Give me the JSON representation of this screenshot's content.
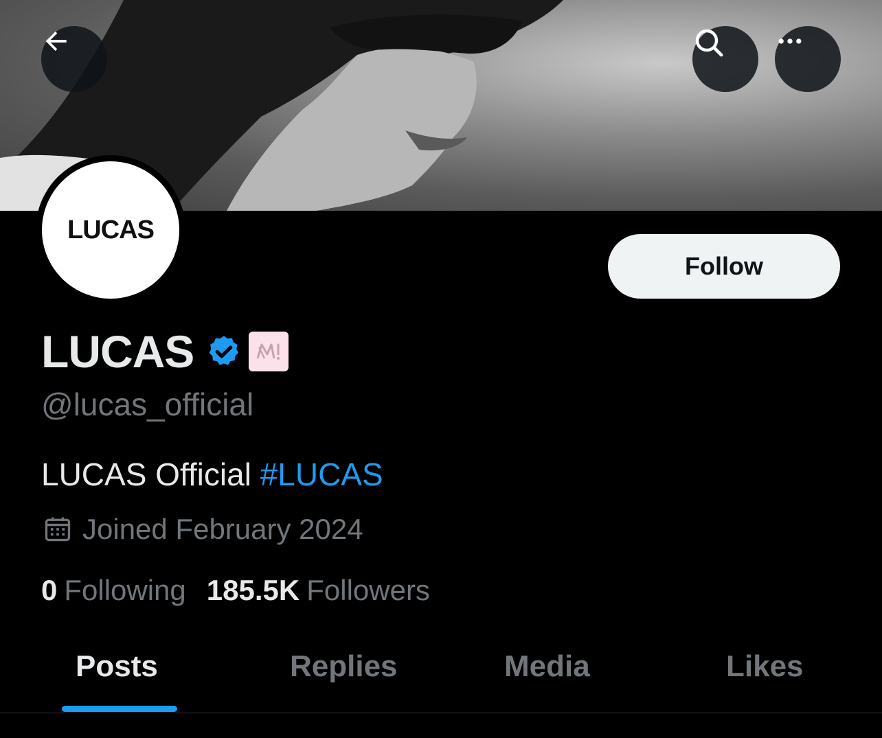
{
  "profile": {
    "display_name": "LUCAS",
    "handle": "@lucas_official",
    "avatar_text": "LUCAS",
    "bio_text": "LUCAS Official ",
    "bio_hashtag": "#LUCAS",
    "joined": "Joined February 2024",
    "following_count": "0",
    "following_label": "Following",
    "followers_count": "185.5K",
    "followers_label": "Followers"
  },
  "actions": {
    "follow_label": "Follow"
  },
  "tabs": [
    {
      "label": "Posts",
      "active": true
    },
    {
      "label": "Replies",
      "active": false
    },
    {
      "label": "Media",
      "active": false
    },
    {
      "label": "Likes",
      "active": false
    }
  ],
  "colors": {
    "background": "#000000",
    "accent": "#1d9bf0",
    "muted": "#71767b",
    "text": "#e7e9ea",
    "follow_button": "#eff3f4"
  },
  "icons": {
    "back": "back-arrow-icon",
    "search": "search-icon",
    "more": "more-horizontal-icon",
    "verified": "verified-badge-icon",
    "affiliate": "sm-entertainment-affiliate-icon",
    "calendar": "calendar-icon"
  }
}
